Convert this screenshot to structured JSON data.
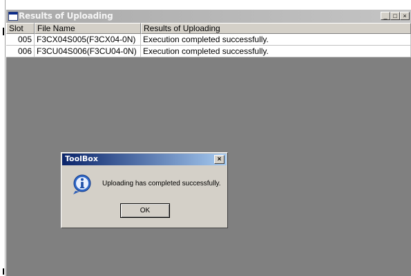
{
  "window": {
    "title": "Results of Uploading",
    "buttons": [
      "_",
      "□",
      "×"
    ]
  },
  "table": {
    "columns": [
      "Slot",
      "File Name",
      "Results of Uploading"
    ],
    "rows": [
      {
        "slot": "005",
        "file_name": "F3CX04S005(F3CX04-0N)",
        "result": "Execution completed successfully."
      },
      {
        "slot": "006",
        "file_name": "F3CU04S006(F3CU04-0N)",
        "result": "Execution completed successfully."
      }
    ]
  },
  "dialog": {
    "title": "ToolBox",
    "close_glyph": "×",
    "message": "Uploading has completed successfully.",
    "ok_label": "OK",
    "icon": "info-icon"
  },
  "colors": {
    "workspace": "#808080",
    "dialog_title_start": "#0a246a",
    "dialog_title_end": "#a6caf0",
    "face": "#d4d0c8"
  }
}
